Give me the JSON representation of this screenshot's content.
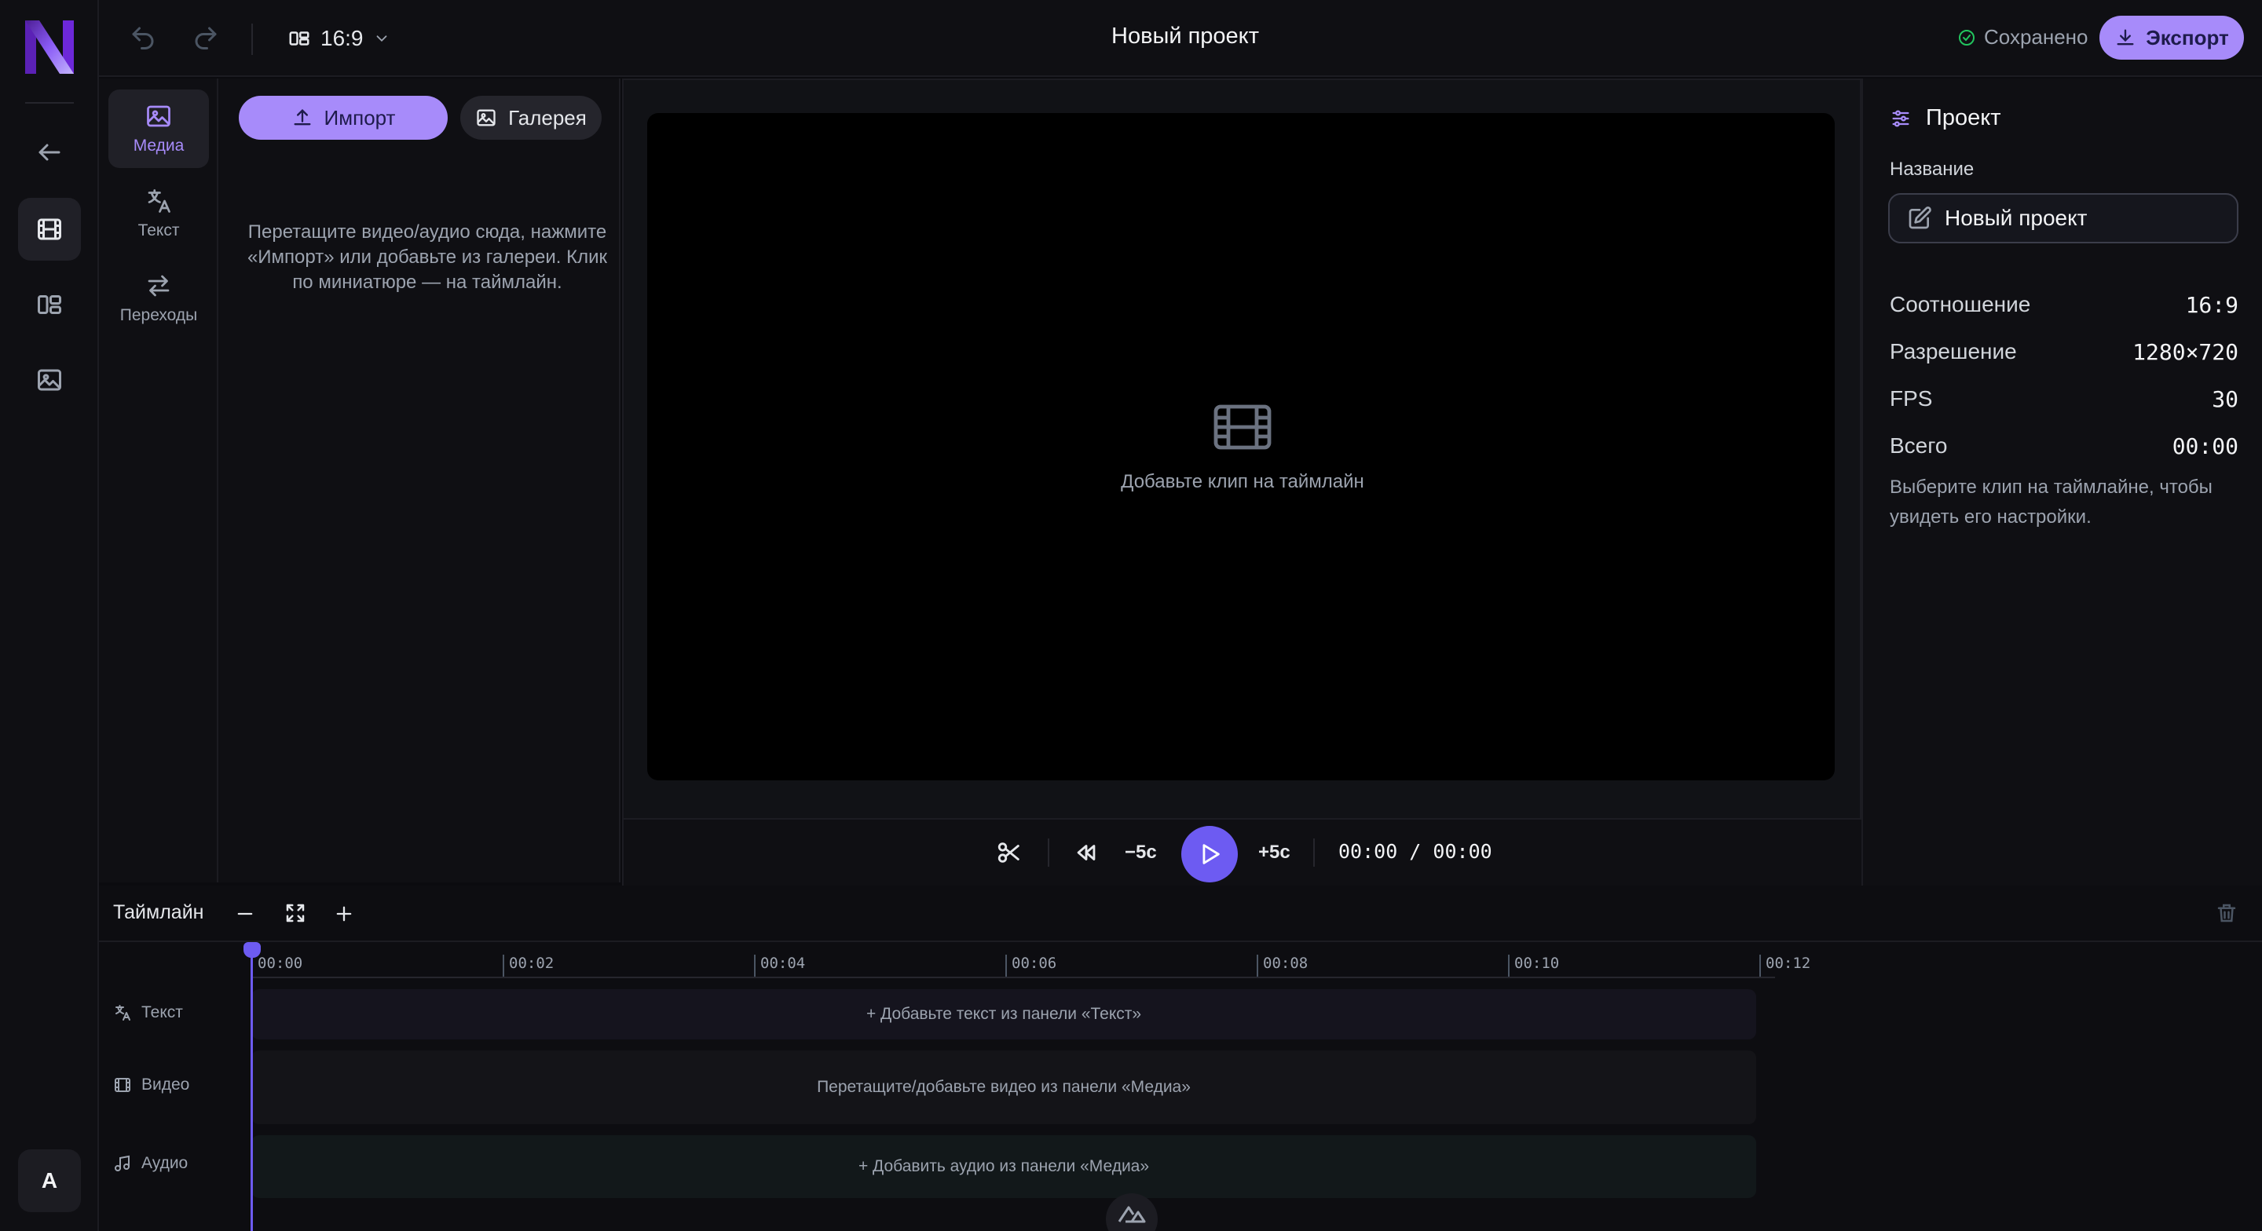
{
  "header": {
    "title": "Новый проект",
    "aspect": "16:9",
    "saved": "Сохранено",
    "export": "Экспорт"
  },
  "tools": [
    {
      "label": "Медиа",
      "icon": "image-icon",
      "active": true
    },
    {
      "label": "Текст",
      "icon": "translate-icon",
      "active": false
    },
    {
      "label": "Переходы",
      "icon": "swap-icon",
      "active": false
    }
  ],
  "media": {
    "import": "Импорт",
    "gallery": "Галерея",
    "hint": "Перетащите видео/аудио сюда, нажмите «Импорт» или добавьте из галереи. Клик по миниатюре — на таймлайн."
  },
  "preview": {
    "empty": "Добавьте клип на таймлайн",
    "back5": "−5с",
    "fwd5": "+5с",
    "timecode": "00:00 / 00:00"
  },
  "project": {
    "heading": "Проект",
    "name_label": "Название",
    "name_value": "Новый проект",
    "props": [
      {
        "k": "Соотношение",
        "v": "16:9"
      },
      {
        "k": "Разрешение",
        "v": "1280×720"
      },
      {
        "k": "FPS",
        "v": "30"
      },
      {
        "k": "Всего",
        "v": "00:00"
      }
    ],
    "hint": "Выберите клип на таймлайне, чтобы увидеть его настройки."
  },
  "timeline": {
    "title": "Таймлайн",
    "ticks": [
      "00:00",
      "00:02",
      "00:04",
      "00:06",
      "00:08",
      "00:10",
      "00:12"
    ],
    "tracks": [
      {
        "label": "Текст",
        "placeholder": "+ Добавьте текст из панели «Текст»"
      },
      {
        "label": "Видео",
        "placeholder": "Перетащите/добавьте видео из панели «Медиа»"
      },
      {
        "label": "Аудио",
        "placeholder": "+ Добавить аудио из панели «Медиа»"
      }
    ]
  },
  "user": {
    "initial": "A"
  },
  "colors": {
    "accent": "#a78bfa",
    "play": "#6d5bf2",
    "background": "#0b0b0f"
  }
}
